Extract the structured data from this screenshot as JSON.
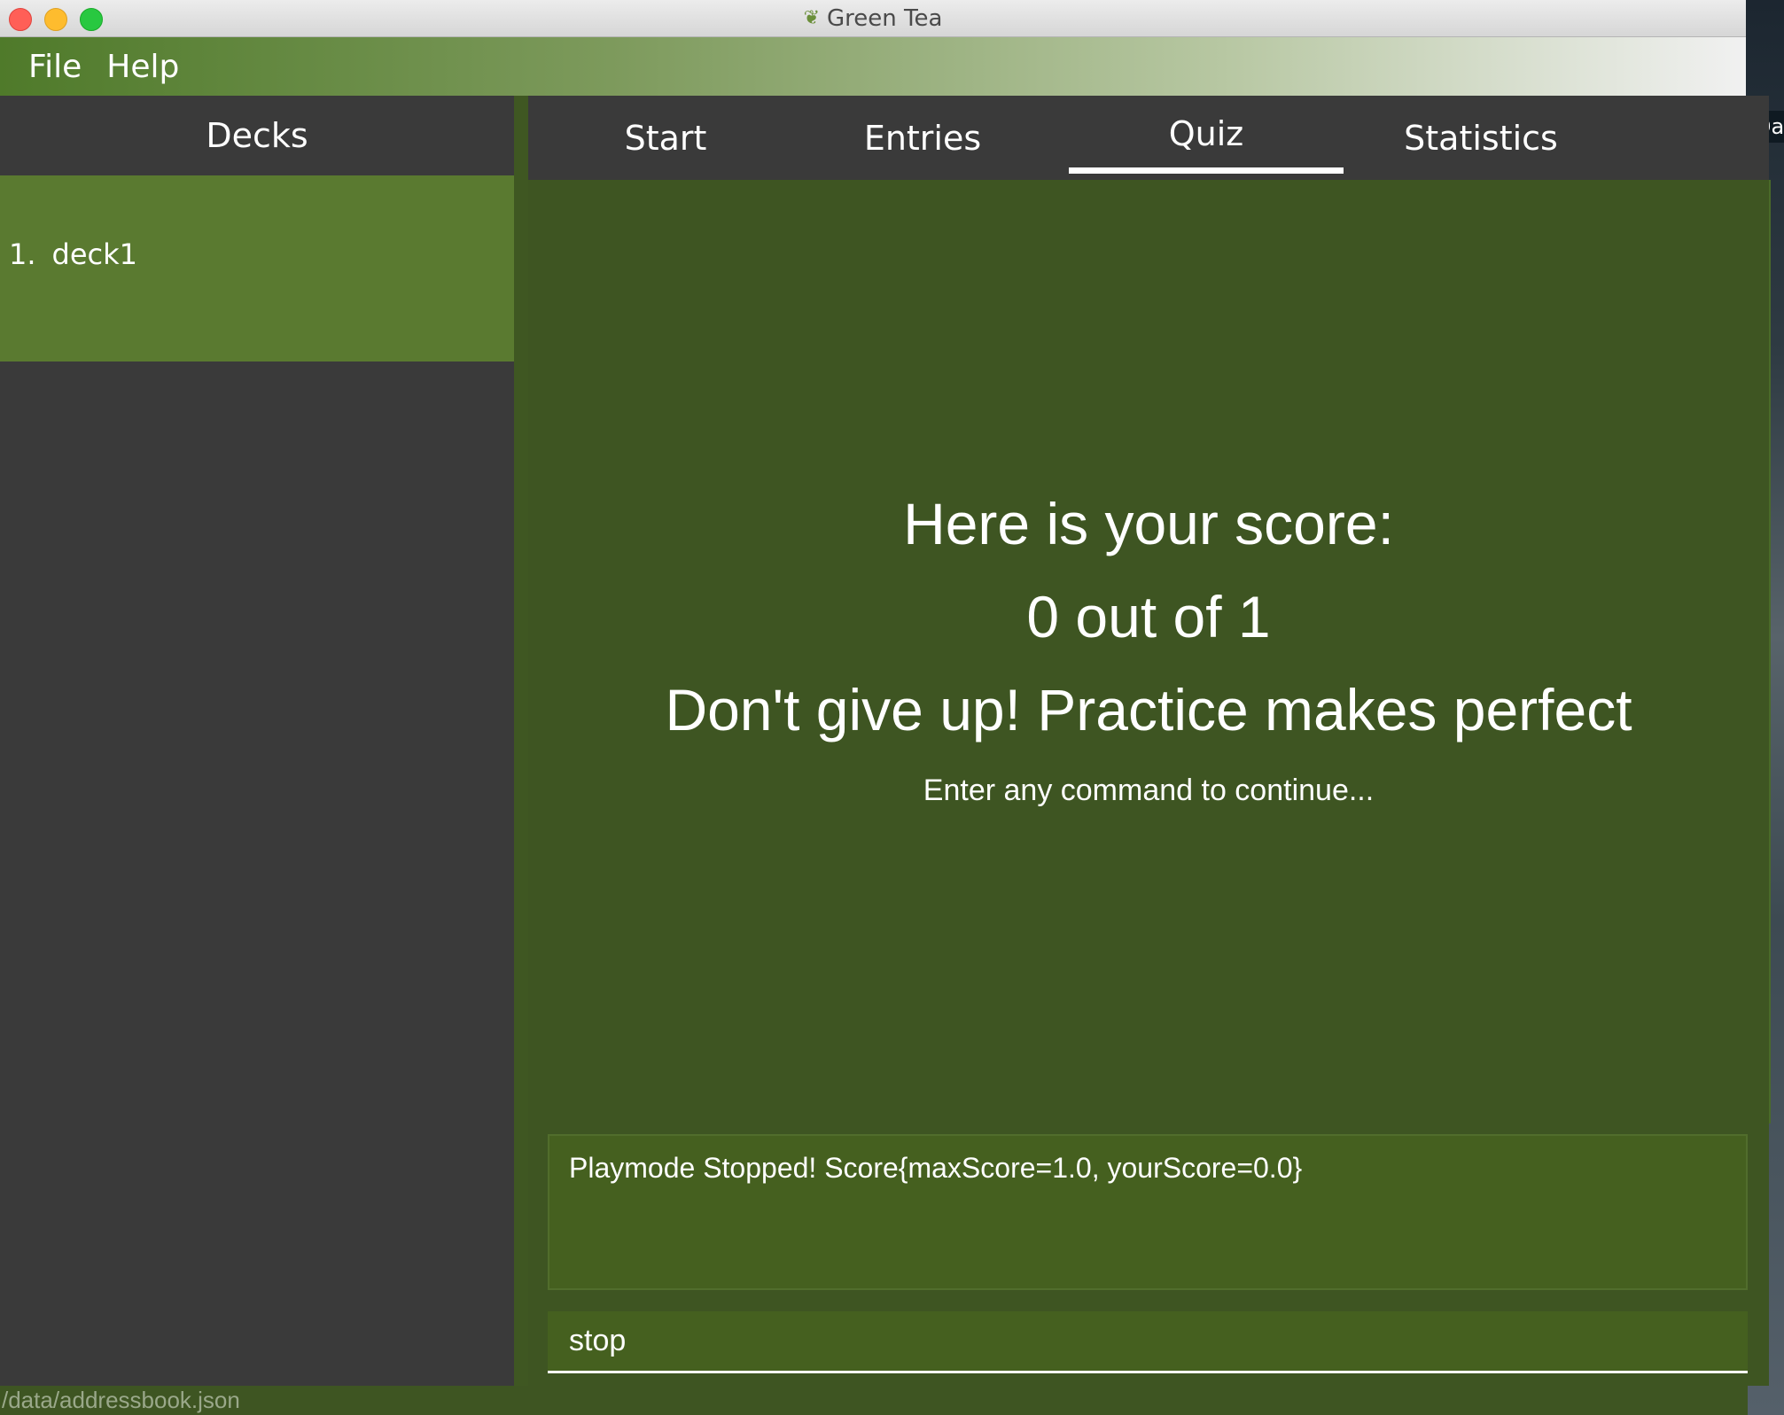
{
  "window": {
    "title": "Green Tea",
    "desktop_peek_text": "Da"
  },
  "menu": {
    "items": [
      "File",
      "Help"
    ]
  },
  "sidebar": {
    "header": "Decks",
    "decks": [
      {
        "index": "1.",
        "name": "deck1"
      }
    ]
  },
  "tabs": [
    {
      "label": "Start",
      "active": false
    },
    {
      "label": "Entries",
      "active": false
    },
    {
      "label": "Quiz",
      "active": true
    },
    {
      "label": "Statistics",
      "active": false
    }
  ],
  "quiz": {
    "heading": "Here is your score:",
    "score": "0 out of 1",
    "message": "Don't give up! Practice makes perfect",
    "prompt": "Enter any command to continue..."
  },
  "result_box": {
    "text": "Playmode Stopped! Score{maxScore=1.0, yourScore=0.0}"
  },
  "command_box": {
    "value": "stop"
  },
  "status_bar": {
    "path": "/data/addressbook.json"
  },
  "colors": {
    "accent_green": "#5a7a30",
    "panel_green": "#3e5522",
    "dark_bg": "#3a3a3a"
  }
}
